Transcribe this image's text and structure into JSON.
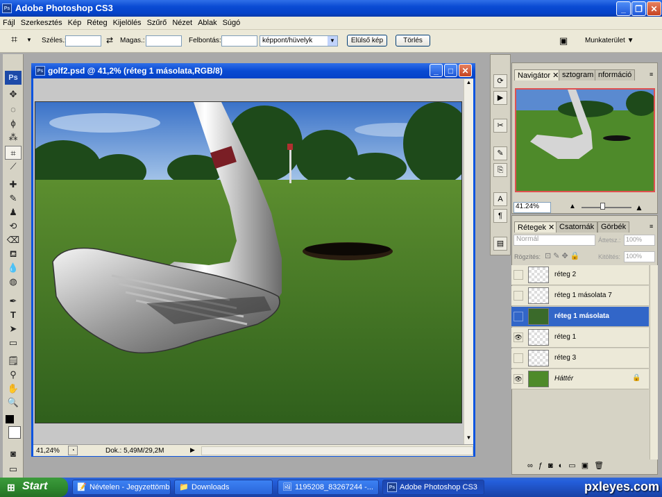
{
  "app": {
    "title": "Adobe Photoshop CS3"
  },
  "menu": [
    "Fájl",
    "Szerkesztés",
    "Kép",
    "Réteg",
    "Kijelölés",
    "Szűrő",
    "Nézet",
    "Ablak",
    "Súgó"
  ],
  "options": {
    "width_label": "Széles.:",
    "height_label": "Magas.:",
    "resolution_label": "Felbontás:",
    "unit_value": "képpont/hüvelyk",
    "front_image_button": "Elülső kép",
    "clear_button": "Törlés",
    "workspace_label": "Munkaterület"
  },
  "document": {
    "title": "golf2.psd @ 41,2% (réteg 1 másolata,RGB/8)",
    "zoom": "41,24%",
    "doc_size": "Dok.: 5,49M/29,2M"
  },
  "navigator": {
    "tabs": [
      "Navigátor",
      "sztogram",
      "nformáció"
    ],
    "zoom": "41.24%"
  },
  "layers_panel": {
    "tabs": [
      "Rétegek",
      "Csatornák",
      "Görbék"
    ],
    "blend_mode": "Normál",
    "opacity_label": "Áttetsz.:",
    "opacity_value": "100%",
    "lock_label": "Rögzítés:",
    "fill_label": "Kitöltés:",
    "fill_value": "100%",
    "layers": [
      {
        "name": "réteg 2",
        "visible": false,
        "selected": false
      },
      {
        "name": "réteg 1 másolata 7",
        "visible": false,
        "selected": false
      },
      {
        "name": "réteg 1 másolata",
        "visible": false,
        "selected": true
      },
      {
        "name": "réteg 1",
        "visible": true,
        "selected": false
      },
      {
        "name": "réteg 3",
        "visible": false,
        "selected": false
      },
      {
        "name": "Háttér",
        "visible": true,
        "selected": false
      }
    ]
  },
  "taskbar": {
    "start": "Start",
    "tasks": [
      "Névtelen - Jegyzettömb",
      "Downloads",
      "1195208_83267244 -...",
      "Adobe Photoshop CS3"
    ]
  },
  "watermark": "pxleyes.com",
  "colors": {
    "xp_blue": "#0a4bd3",
    "selection": "#3266c8",
    "panel": "#d6d3c5"
  }
}
